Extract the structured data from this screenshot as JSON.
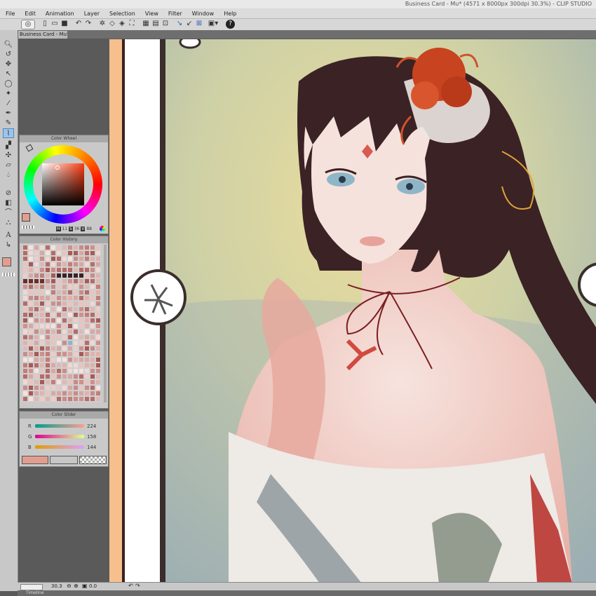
{
  "window": {
    "title": "Business Card - Mu* (4571 x 8000px 300dpi 30.3%) - CLIP STUDIO"
  },
  "menu": [
    "File",
    "Edit",
    "Animation",
    "Layer",
    "Selection",
    "View",
    "Filter",
    "Window",
    "Help"
  ],
  "document_tab": {
    "label": "Business Card - Mu*"
  },
  "panels": {
    "color_wheel": {
      "title": "Color Wheel",
      "h": "11",
      "s": "36",
      "v": "88"
    },
    "color_history": {
      "title": "Color History"
    },
    "color_slider": {
      "title": "Color Slider",
      "channels": [
        {
          "label": "R",
          "value": "224"
        },
        {
          "label": "G",
          "value": "158"
        },
        {
          "label": "B",
          "value": "144"
        }
      ]
    }
  },
  "status": {
    "zoom": "30.3",
    "angle": "0.0"
  },
  "timeline": {
    "label": "Timeline"
  },
  "colors": {
    "main": "#e09e90",
    "accent": "#f5c08e"
  }
}
